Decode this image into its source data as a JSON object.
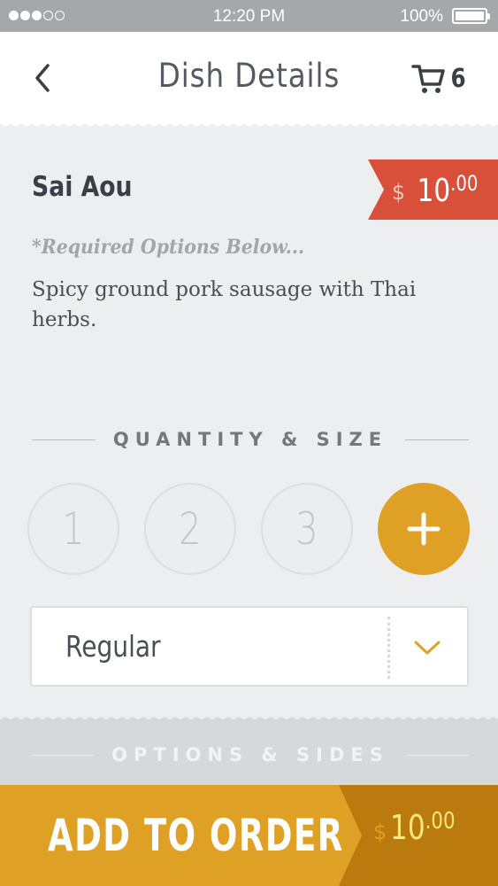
{
  "status_bar": {
    "time": "12:20 PM",
    "battery_percent": "100%",
    "signal_bars_filled": 3,
    "signal_bars_total": 5
  },
  "header": {
    "title": "Dish Details",
    "back_icon": "chevron-left-icon",
    "cart_icon": "cart-icon",
    "cart_count": "6"
  },
  "dish": {
    "name": "Sai Aou",
    "price_currency": "$",
    "price_whole": "10",
    "price_cents": ".00",
    "required_note": "*Required Options Below...",
    "description": "Spicy ground pork sausage with Thai herbs."
  },
  "quantity": {
    "section_label": "QUANTITY & SIZE",
    "options": [
      "1",
      "2",
      "3"
    ],
    "add_icon": "plus-icon"
  },
  "size": {
    "selected": "Regular",
    "dropdown_icon": "chevron-down-icon"
  },
  "options_section": {
    "label": "OPTIONS & SIDES"
  },
  "order": {
    "button_label": "ADD TO ORDER",
    "price_currency": "$",
    "price_whole": "10",
    "price_cents": ".00"
  },
  "colors": {
    "accent": "#dfa125",
    "accent_dark": "#bb7a0d",
    "price_tag": "#d9503a",
    "background": "#eceef0"
  }
}
